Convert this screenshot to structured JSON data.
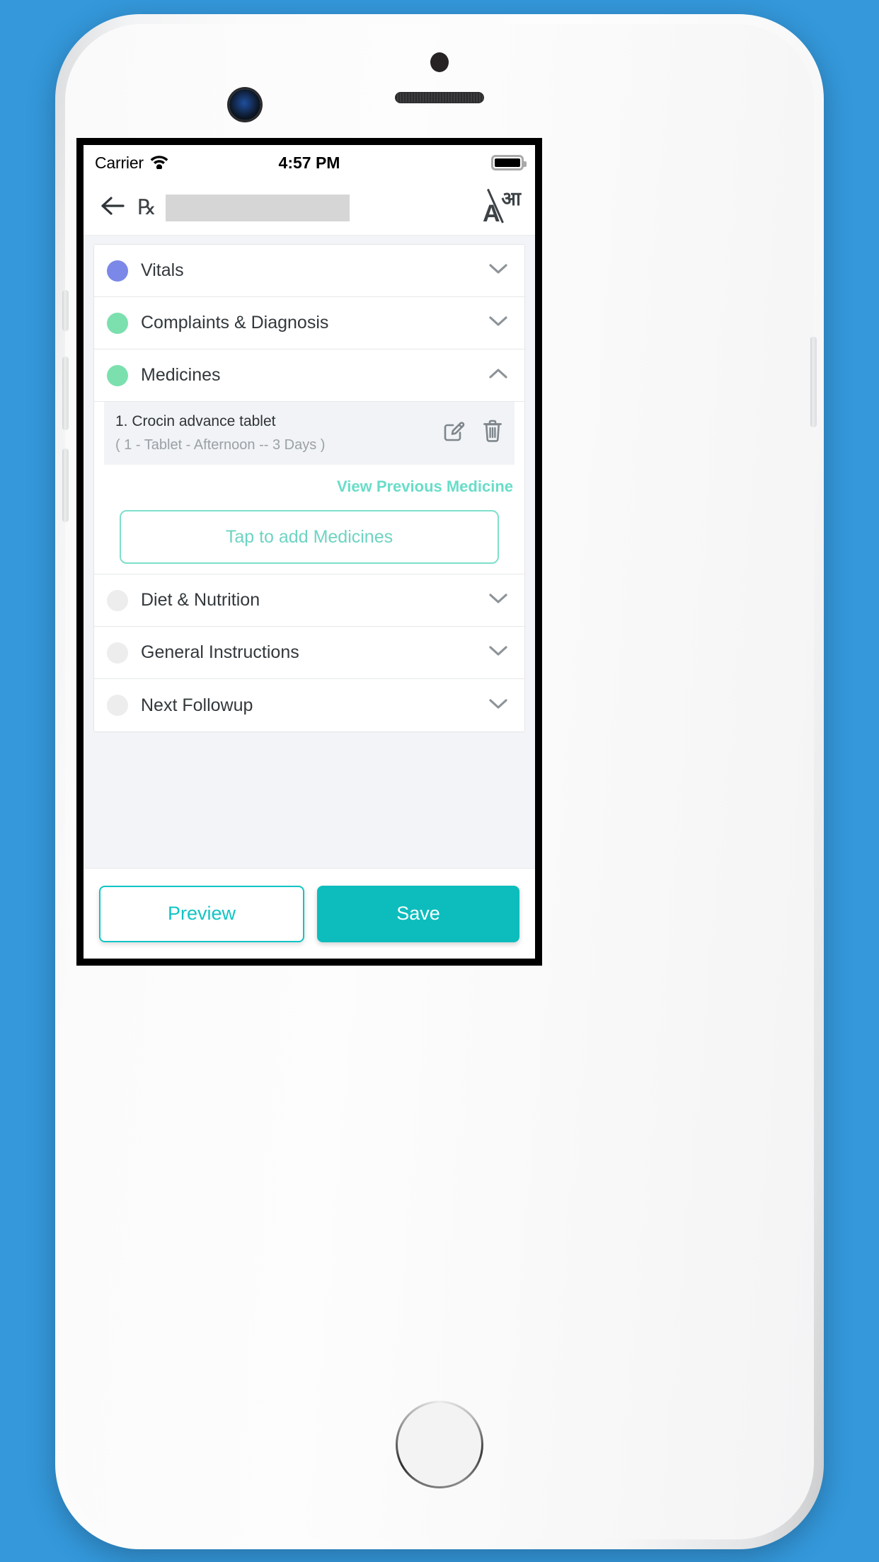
{
  "theme": {
    "page_background": "#3498db",
    "accent_teal": "#0dbdbd",
    "link_mint": "#69ddc8",
    "dot_vitals": "#7b88e8",
    "dot_filled_green": "#7be0ae",
    "dot_empty_gray": "#ededee"
  },
  "status_bar": {
    "carrier": "Carrier",
    "wifi_icon": "wifi-icon",
    "time": "4:57 PM",
    "battery_icon": "battery-full-icon",
    "battery_level_percent": 100
  },
  "nav_bar": {
    "back_icon": "back-arrow-icon",
    "rx_symbol": "℞",
    "title_value": "",
    "title_redacted": true,
    "language_toggle": {
      "icon": "translate-icon",
      "latin_glyph": "A",
      "devanagari_glyph": "आ"
    }
  },
  "sections": [
    {
      "label": "Vitals",
      "dot_color": "#7b88e8",
      "expanded": false,
      "chevron": "chevron-down-icon"
    },
    {
      "label": "Complaints & Diagnosis",
      "dot_color": "#7be0ae",
      "expanded": false,
      "chevron": "chevron-down-icon"
    },
    {
      "label": "Medicines",
      "dot_color": "#7be0ae",
      "expanded": true,
      "chevron": "chevron-up-icon"
    },
    {
      "label": "Diet & Nutrition",
      "dot_color": "#ededee",
      "expanded": false,
      "chevron": "chevron-down-icon"
    },
    {
      "label": "General Instructions",
      "dot_color": "#ededee",
      "expanded": false,
      "chevron": "chevron-down-icon"
    },
    {
      "label": "Next Followup",
      "dot_color": "#ededee",
      "expanded": false,
      "chevron": "chevron-down-icon"
    }
  ],
  "medicines_panel": {
    "items": [
      {
        "index_label": "1.",
        "name": "Crocin advance tablet",
        "dosage": "( 1 - Tablet - Afternoon -- 3 Days )",
        "edit_icon": "edit-pencil-icon",
        "delete_icon": "trash-icon"
      }
    ],
    "view_previous_label": "View Previous Medicine",
    "add_button_label": "Tap to add Medicines"
  },
  "action_bar": {
    "preview_label": "Preview",
    "save_label": "Save"
  }
}
